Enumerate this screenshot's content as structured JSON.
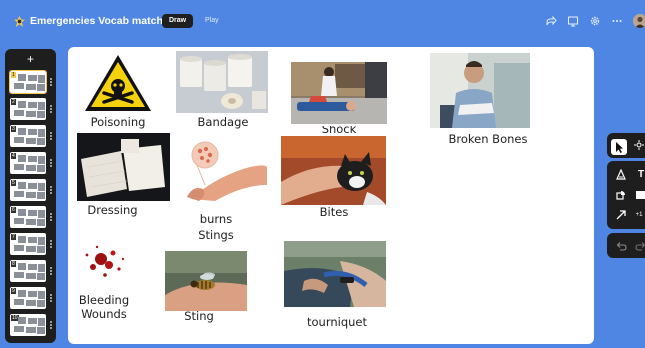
{
  "app": {
    "title": "Emergencies Vocab matching",
    "tabs": [
      {
        "label": "Draw",
        "active": true
      },
      {
        "label": "Play",
        "active": false
      }
    ]
  },
  "toolbar_icons": [
    "share-icon",
    "present-icon",
    "settings-icon",
    "more-icon",
    "user-avatar"
  ],
  "slides": {
    "add_label": "+",
    "items": [
      {
        "number": "1",
        "active": true
      },
      {
        "number": "2"
      },
      {
        "number": "3"
      },
      {
        "number": "4"
      },
      {
        "number": "5"
      },
      {
        "number": "6"
      },
      {
        "number": "7"
      },
      {
        "number": "8"
      },
      {
        "number": "9"
      },
      {
        "number": "10"
      }
    ]
  },
  "canvas": {
    "cards": [
      {
        "word": "Poisoning",
        "image": "poison-hazard-sign-icon"
      },
      {
        "word": "Bandage",
        "image": "bandage-rolls-photo"
      },
      {
        "word": "Shock",
        "image": "shock-first-aid-photo"
      },
      {
        "word": "Broken Bones",
        "image": "broken-arm-photo"
      },
      {
        "word": "Dressing",
        "image": "gauze-dressing-photo"
      },
      {
        "word": "burns",
        "word2": "Stings",
        "image": "burn-on-arm-photo"
      },
      {
        "word": "Bites",
        "image": "cat-bite-photo"
      },
      {
        "word": "Bleeding",
        "word2": "Wounds",
        "image": "blood-splatter-photo"
      },
      {
        "word": "Sting",
        "image": "bee-sting-photo"
      },
      {
        "word": "tourniquet",
        "image": "tourniquet-photo"
      }
    ]
  },
  "tools": {
    "top_text": "T",
    "side_label": "+1"
  },
  "colors": {
    "background": "#4f86e3",
    "panel": "#1e1e1e",
    "canvas": "#ffffff",
    "active_slide": "#f2c94c"
  }
}
